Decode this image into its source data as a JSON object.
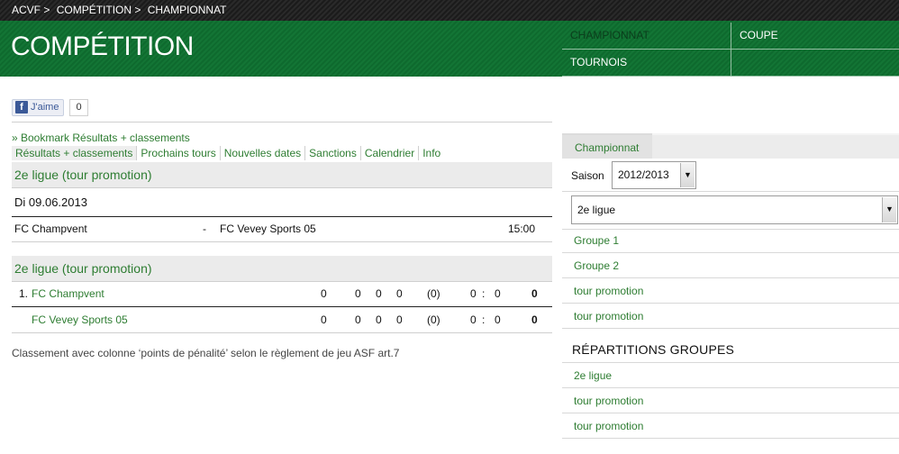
{
  "breadcrumb": [
    "ACVF >",
    "COMPÉTITION >",
    "CHAMPIONNAT"
  ],
  "header": {
    "title": "COMPÉTITION",
    "nav": [
      {
        "label": "CHAMPIONNAT",
        "selected": true
      },
      {
        "label": "COUPE",
        "selected": false
      },
      {
        "label": "TOURNOIS",
        "selected": false
      },
      {
        "label": "",
        "selected": false
      }
    ]
  },
  "like": {
    "label": "J'aime",
    "count": "0"
  },
  "bookmark": "» Bookmark Résultats + classements",
  "tabs": [
    "Résultats + classements",
    "Prochains tours",
    "Nouvelles dates",
    "Sanctions",
    "Calendrier",
    "Info"
  ],
  "results": {
    "heading": "2e ligue (tour promotion)",
    "date": "Di 09.06.2013",
    "match": {
      "home": "FC Champvent",
      "sep": "-",
      "away": "FC Vevey Sports 05",
      "time": "15:00"
    }
  },
  "standings": {
    "heading": "2e ligue (tour promotion)",
    "rows": [
      {
        "pos": "1.",
        "team": "FC Champvent",
        "c1": "0",
        "c2": "0",
        "c3": "0",
        "c4": "0",
        "pen": "(0)",
        "gf": "0",
        "colon": ":",
        "ga": "0",
        "pts": "0"
      },
      {
        "pos": "",
        "team": "FC Vevey Sports 05",
        "c1": "0",
        "c2": "0",
        "c3": "0",
        "c4": "0",
        "pen": "(0)",
        "gf": "0",
        "colon": ":",
        "ga": "0",
        "pts": "0"
      }
    ]
  },
  "note": "Classement avec colonne ‘points de pénalité’ selon le règlement de jeu ASF art.7",
  "panel": {
    "tab": "Championnat",
    "saison_label": "Saison",
    "saison_value": "2012/2013",
    "league_value": "2e ligue",
    "groups": [
      "Groupe  1",
      "Groupe  2",
      "tour promotion",
      "tour promotion"
    ],
    "repartitions_heading": "RÉPARTITIONS GROUPES",
    "repartitions": [
      "2e ligue",
      "tour promotion",
      "tour promotion"
    ]
  }
}
